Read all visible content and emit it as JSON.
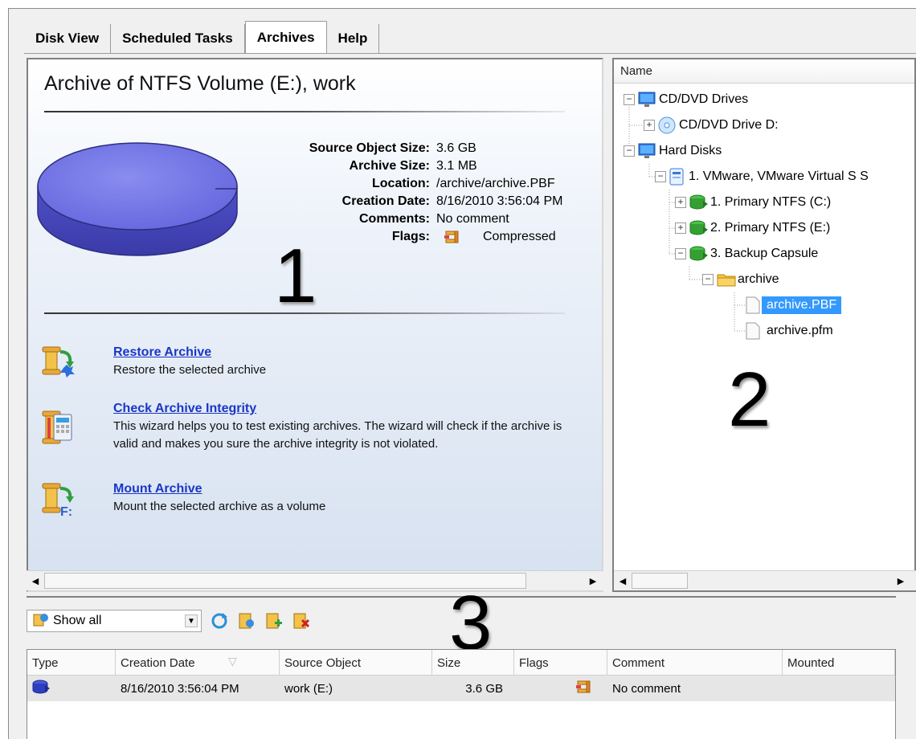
{
  "tabs": [
    {
      "label": "Disk View",
      "active": false
    },
    {
      "label": "Scheduled Tasks",
      "active": false
    },
    {
      "label": "Archives",
      "active": true
    },
    {
      "label": "Help",
      "active": false
    }
  ],
  "archive": {
    "title": "Archive of NTFS Volume (E:), work",
    "properties": [
      {
        "label": "Source Object Size:",
        "value": "3.6 GB"
      },
      {
        "label": "Archive Size:",
        "value": "3.1 MB"
      },
      {
        "label": "Location:",
        "value": "/archive/archive.PBF"
      },
      {
        "label": "Creation Date:",
        "value": "8/16/2010 3:56:04 PM"
      },
      {
        "label": "Comments:",
        "value": "No comment"
      },
      {
        "label": "Flags:",
        "value": "Compressed",
        "icon": "compressed-flag-icon"
      }
    ]
  },
  "annotations": {
    "one": "1",
    "two": "2",
    "three": "3"
  },
  "actions": [
    {
      "link": "Restore Archive",
      "desc": "Restore the selected archive",
      "icon": "restore-archive-icon"
    },
    {
      "link": "Check Archive Integrity",
      "desc": "This wizard helps you to test existing archives. The wizard will check if the archive is valid and makes you sure the archive integrity is not violated.",
      "icon": "check-integrity-icon"
    },
    {
      "link": "Mount Archive",
      "desc": "Mount the selected archive as a volume",
      "icon": "mount-archive-icon"
    }
  ],
  "tree": {
    "header": "Name",
    "items": [
      {
        "label": "CD/DVD Drives",
        "icon": "monitor-icon",
        "expander": "−"
      },
      {
        "label": "CD/DVD Drive D:",
        "icon": "cd-icon",
        "expander": "+"
      },
      {
        "label": "Hard Disks",
        "icon": "monitor-icon",
        "expander": "−"
      },
      {
        "label": "1. VMware, VMware Virtual S S",
        "icon": "hard-disk-icon",
        "expander": "−"
      },
      {
        "label": "1. Primary NTFS (C:)",
        "icon": "volume-icon",
        "expander": "+"
      },
      {
        "label": "2. Primary NTFS (E:)",
        "icon": "volume-icon",
        "expander": "+"
      },
      {
        "label": "3. Backup Capsule",
        "icon": "volume-icon",
        "expander": "−"
      },
      {
        "label": "archive",
        "icon": "folder-icon",
        "expander": "−"
      },
      {
        "label": "archive.PBF",
        "icon": "file-icon",
        "expander": "",
        "selected": true
      },
      {
        "label": "archive.pfm",
        "icon": "file-icon",
        "expander": ""
      }
    ]
  },
  "bottom": {
    "filter_value": "Show all",
    "columns": [
      "Type",
      "Creation Date",
      "Source Object",
      "Size",
      "Flags",
      "Comment",
      "Mounted"
    ],
    "rows": [
      {
        "type_icon": "archive-type-icon",
        "creation_date": "8/16/2010 3:56:04 PM",
        "source_object": "work (E:)",
        "size": "3.6 GB",
        "flags_icon": "compressed-flag-icon",
        "comment": "No comment",
        "mounted": ""
      }
    ]
  },
  "colors": {
    "link": "#1a36c7",
    "selection": "#3399ff",
    "disk": "#6b6de0"
  }
}
